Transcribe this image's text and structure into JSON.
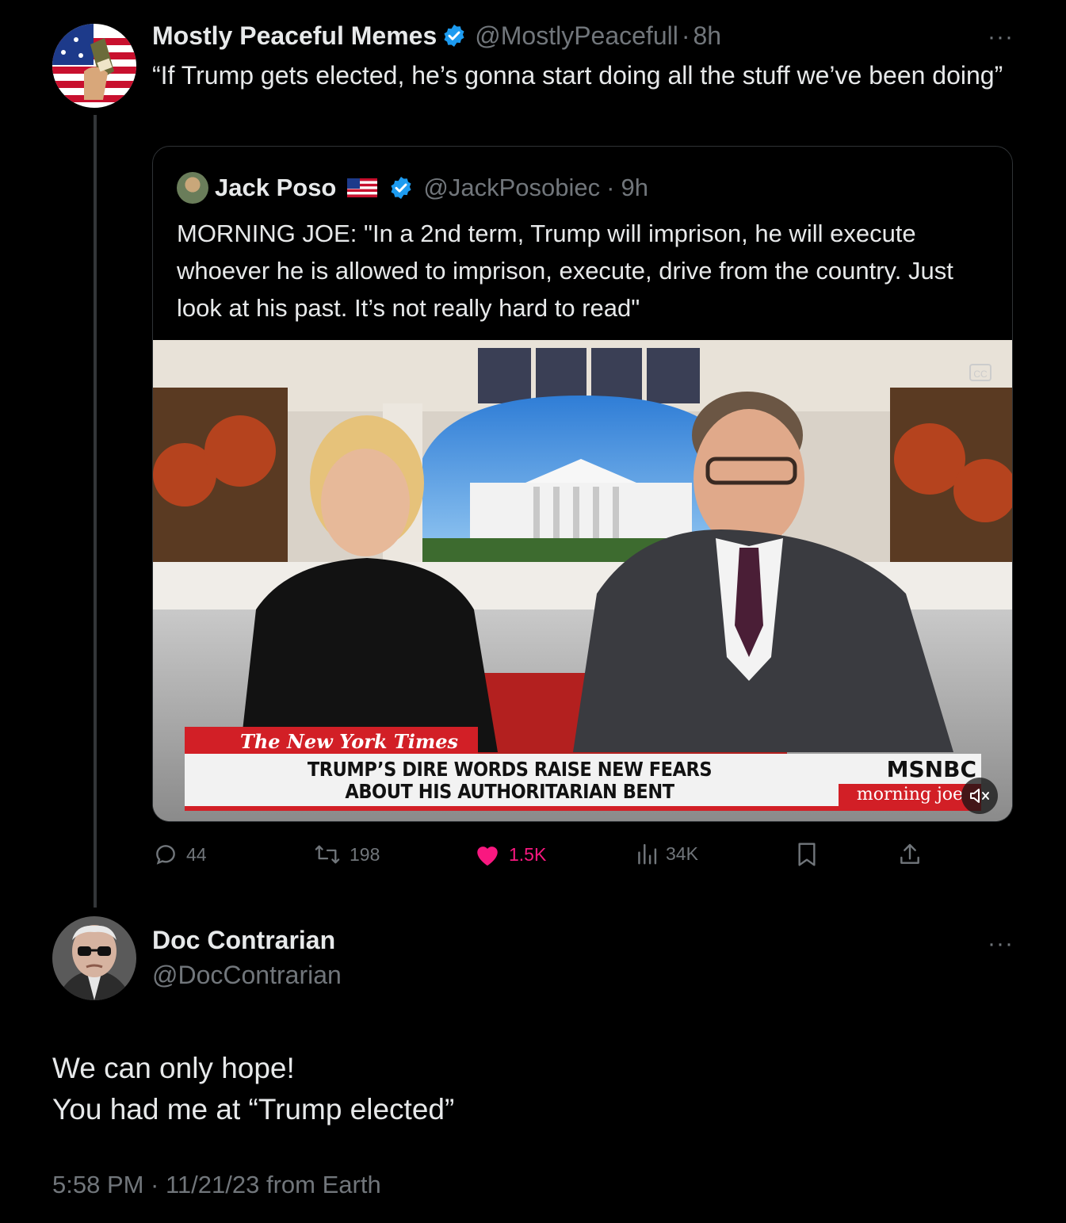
{
  "parent_tweet": {
    "author_name": "Mostly Peaceful Memes",
    "handle": "@MostlyPeacefull",
    "separator": "·",
    "time": "8h",
    "more_label": "···",
    "text": "“If Trump gets elected, he’s gonna start doing all the stuff we’ve been doing”"
  },
  "quoted_tweet": {
    "author_name": "Jack Poso",
    "handle": "@JackPosobiec",
    "separator": "·",
    "time": "9h",
    "text": "MORNING JOE: \"In a 2nd term, Trump will imprison, he will execute whoever he is allowed to imprison, execute, drive from the country. Just look at his past. It’s not really hard to read\"",
    "video": {
      "chyron_source": "The New York Times",
      "chyron_line1": "TRUMP’S DIRE WORDS RAISE NEW FEARS",
      "chyron_line2": "ABOUT HIS AUTHORITARIAN BENT",
      "network": "MSNBC",
      "show": "morning joe",
      "cc_label": "CC"
    }
  },
  "actions": {
    "replies": "44",
    "reposts": "198",
    "likes": "1.5K",
    "views": "34K"
  },
  "reply_tweet": {
    "author_name": "Doc Contrarian",
    "handle": "@DocContrarian",
    "more_label": "···",
    "text_line1": "We can only hope!",
    "text_line2": "You had me at “Trump elected”",
    "meta": "5:58 PM · 11/21/23 from Earth"
  },
  "colors": {
    "background": "#000000",
    "text": "#e7e9ea",
    "secondary": "#71767b",
    "verified": "#1d9bf0",
    "like": "#f91880"
  },
  "icons": [
    "verified-badge-icon",
    "more-icon",
    "reply-icon",
    "repost-icon",
    "like-icon",
    "views-icon",
    "bookmark-icon",
    "share-icon",
    "mute-icon",
    "cc-icon"
  ]
}
